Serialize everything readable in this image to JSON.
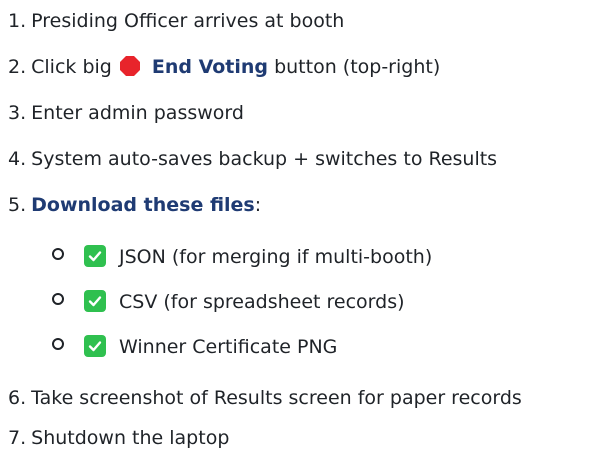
{
  "steps": [
    {
      "num": "1.",
      "text": "Presiding Officer arrives at booth"
    },
    {
      "num": "2.",
      "pre": "Click big",
      "strong": "End Voting",
      "post": " button (top-right)",
      "icon": "stop-sign-icon"
    },
    {
      "num": "3.",
      "text": "Enter admin password"
    },
    {
      "num": "4.",
      "text": "System auto-saves backup + switches to Results"
    },
    {
      "num": "5.",
      "strong": "Download these files",
      "post": ":"
    },
    {
      "num": "6.",
      "text": "Take screenshot of Results screen for paper records"
    },
    {
      "num": "7.",
      "text": "Shutdown the laptop"
    }
  ],
  "files": [
    {
      "label": "JSON (for merging if multi-booth)",
      "icon": "checkmark-box-icon"
    },
    {
      "label": "CSV (for spreadsheet records)",
      "icon": "checkmark-box-icon"
    },
    {
      "label": "Winner Certificate PNG",
      "icon": "checkmark-box-icon"
    }
  ],
  "colors": {
    "text": "#1f2328",
    "emphasis": "#1f3b73",
    "stop_icon": "#e8242b",
    "check_box": "#2fc04f"
  }
}
